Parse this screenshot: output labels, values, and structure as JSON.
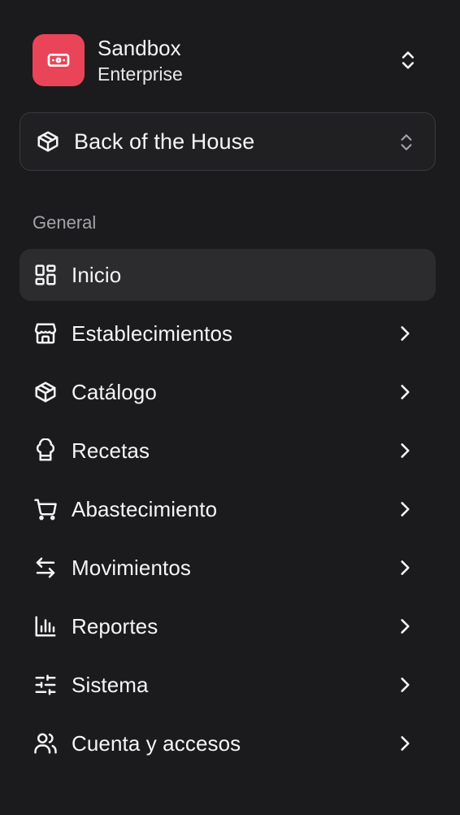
{
  "org": {
    "name": "Sandbox",
    "plan": "Enterprise",
    "logo_icon": "banknote-icon",
    "logo_color": "#ea4459",
    "switch_icon": "chevrons-up-down-icon"
  },
  "location": {
    "label": "Back of the House",
    "icon": "box-icon",
    "switch_icon": "chevrons-up-down-icon"
  },
  "nav": {
    "section_label": "General",
    "items": [
      {
        "label": "Inicio",
        "icon": "layout-dashboard-icon",
        "active": true,
        "has_submenu": false
      },
      {
        "label": "Establecimientos",
        "icon": "store-icon",
        "active": false,
        "has_submenu": true
      },
      {
        "label": "Catálogo",
        "icon": "box-icon",
        "active": false,
        "has_submenu": true
      },
      {
        "label": "Recetas",
        "icon": "chef-hat-icon",
        "active": false,
        "has_submenu": true
      },
      {
        "label": "Abastecimiento",
        "icon": "shopping-cart-icon",
        "active": false,
        "has_submenu": true
      },
      {
        "label": "Movimientos",
        "icon": "arrow-left-right-icon",
        "active": false,
        "has_submenu": true
      },
      {
        "label": "Reportes",
        "icon": "bar-chart-icon",
        "active": false,
        "has_submenu": true
      },
      {
        "label": "Sistema",
        "icon": "sliders-icon",
        "active": false,
        "has_submenu": true
      },
      {
        "label": "Cuenta y accesos",
        "icon": "users-icon",
        "active": false,
        "has_submenu": true
      }
    ]
  },
  "colors": {
    "background": "#1b1b1d",
    "active_item_bg": "#2c2c2f",
    "text": "#f5f5f7",
    "muted_text": "#a3a3a8",
    "accent": "#ea4459"
  }
}
